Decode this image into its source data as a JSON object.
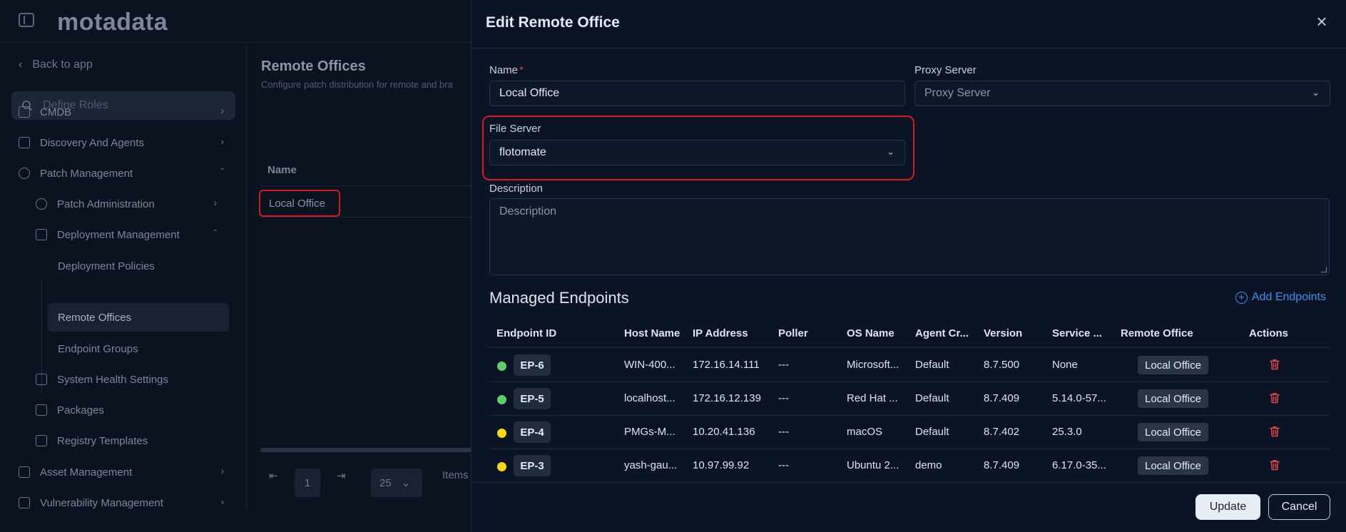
{
  "app": {
    "logo_text": "motadata"
  },
  "sidebar": {
    "back_label": "Back to app",
    "search_placeholder": "Define Roles",
    "items": [
      {
        "label": "CMDB",
        "icon": "cmdb-icon"
      },
      {
        "label": "Discovery And Agents",
        "icon": "discovery-icon"
      },
      {
        "label": "Patch Management",
        "icon": "patch-icon"
      },
      {
        "label": "Patch Administration",
        "icon": "admin-icon"
      },
      {
        "label": "Deployment Management",
        "icon": "deployment-icon"
      },
      {
        "label": "Deployment Policies"
      },
      {
        "label": "Remote Offices"
      },
      {
        "label": "Endpoint Groups"
      },
      {
        "label": "System Health Settings",
        "icon": "health-icon"
      },
      {
        "label": "Packages",
        "icon": "package-icon"
      },
      {
        "label": "Registry Templates",
        "icon": "registry-icon"
      },
      {
        "label": "Asset Management",
        "icon": "asset-icon"
      },
      {
        "label": "Vulnerability Management",
        "icon": "vulnerability-icon"
      }
    ]
  },
  "main": {
    "title": "Remote Offices",
    "subtitle": "Configure patch distribution for remote and bra",
    "column_name": "Name",
    "row_name": "Local Office",
    "page_number": "1",
    "per_page": "25",
    "items_label": "Items"
  },
  "modal": {
    "title": "Edit Remote Office",
    "name_label": "Name",
    "required_mark": "*",
    "name_value": "Local Office",
    "proxy_label": "Proxy Server",
    "proxy_placeholder": "Proxy Server",
    "file_server_label": "File Server",
    "file_server_value": "flotomate",
    "description_label": "Description",
    "description_placeholder": "Description",
    "endpoints_title": "Managed Endpoints",
    "add_endpoints_label": "Add Endpoints",
    "columns": [
      "Endpoint ID",
      "Host Name",
      "IP Address",
      "Poller",
      "OS Name",
      "Agent Cr...",
      "Version",
      "Service ...",
      "Remote Office",
      "Actions"
    ],
    "rows": [
      {
        "status_color": "#5fce6b",
        "id": "EP-6",
        "host": "WIN-400...",
        "ip": "172.16.14.111",
        "poller": "---",
        "os": "Microsoft...",
        "agent": "Default",
        "version": "8.7.500",
        "service": "None",
        "office": "Local Office"
      },
      {
        "status_color": "#5fce6b",
        "id": "EP-5",
        "host": "localhost...",
        "ip": "172.16.12.139",
        "poller": "---",
        "os": "Red Hat ...",
        "agent": "Default",
        "version": "8.7.409",
        "service": "5.14.0-57...",
        "office": "Local Office"
      },
      {
        "status_color": "#f5d90a",
        "id": "EP-4",
        "host": "PMGs-M...",
        "ip": "10.20.41.136",
        "poller": "---",
        "os": "macOS",
        "agent": "Default",
        "version": "8.7.402",
        "service": "25.3.0",
        "office": "Local Office"
      },
      {
        "status_color": "#f5d90a",
        "id": "EP-3",
        "host": "yash-gau...",
        "ip": "10.97.99.92",
        "poller": "---",
        "os": "Ubuntu 2...",
        "agent": "demo",
        "version": "8.7.409",
        "service": "6.17.0-35...",
        "office": "Local Office"
      }
    ],
    "update_label": "Update",
    "cancel_label": "Cancel"
  }
}
